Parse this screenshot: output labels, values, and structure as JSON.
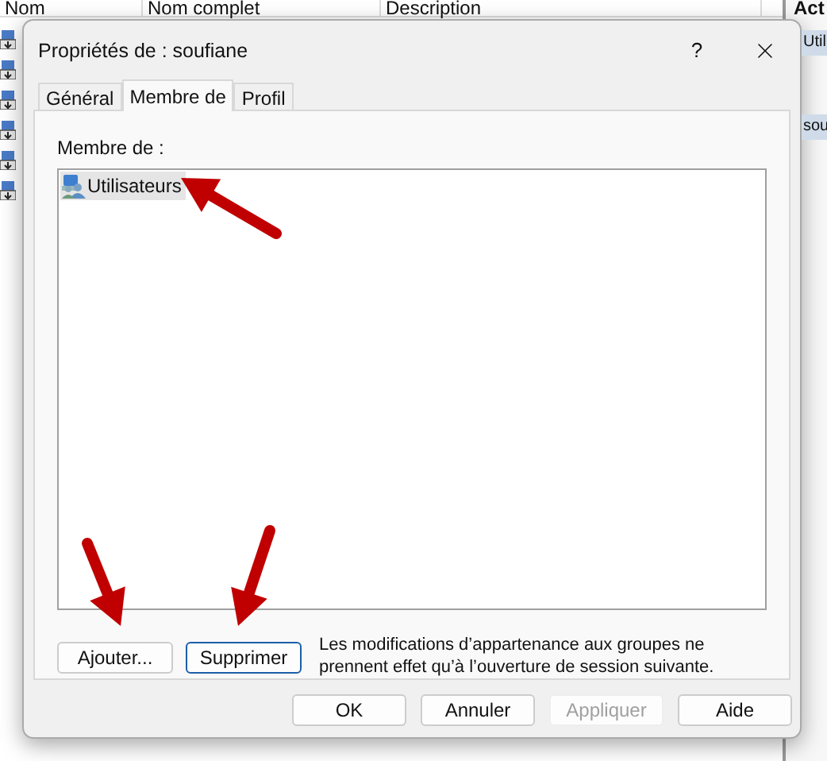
{
  "background_window": {
    "columns": [
      "Nom",
      "Nom complet",
      "Description"
    ],
    "actions_panel": {
      "title": "Act",
      "items": [
        "Util",
        "sou"
      ]
    }
  },
  "dialog": {
    "title": "Propriétés de : soufiane",
    "help_button": "?",
    "tabs": [
      {
        "label": "Général",
        "selected": false
      },
      {
        "label": "Membre de",
        "selected": true
      },
      {
        "label": "Profil",
        "selected": false
      }
    ],
    "member_of_label": "Membre de :",
    "groups": [
      {
        "name": "Utilisateurs",
        "selected": true
      }
    ],
    "add_button": "Ajouter...",
    "remove_button": {
      "label": "Supprimer",
      "focused": true
    },
    "note": "Les modifications d’appartenance aux groupes ne prennent effet qu’à l’ouverture de session suivante.",
    "buttons": [
      {
        "label": "OK",
        "disabled": false
      },
      {
        "label": "Annuler",
        "disabled": false
      },
      {
        "label": "Appliquer",
        "disabled": true
      },
      {
        "label": "Aide",
        "disabled": false
      }
    ]
  }
}
